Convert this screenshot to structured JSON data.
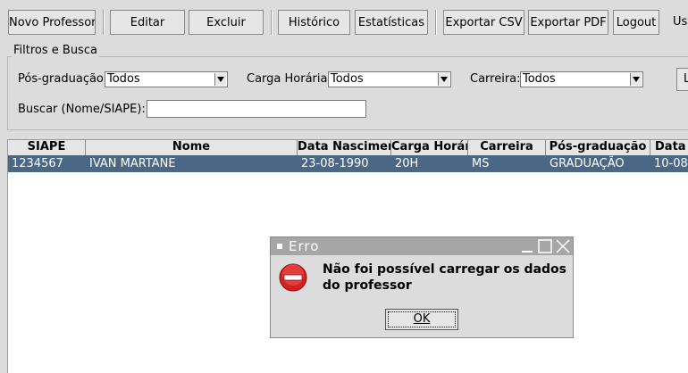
{
  "toolbar": {
    "novo_professor": "Novo Professor",
    "editar": "Editar",
    "excluir": "Excluir",
    "historico": "Histórico",
    "estatisticas": "Estatísticas",
    "exportar_csv": "Exportar CSV",
    "exportar_pdf": "Exportar PDF",
    "logout": "Logout",
    "usuario_partial": "Us"
  },
  "filters": {
    "legend": "Filtros e Busca",
    "pos_label": "Pós-graduação:",
    "pos_value": "Todos",
    "carga_label": "Carga Horária:",
    "carga_value": "Todos",
    "carreira_label": "Carreira:",
    "carreira_value": "Todos",
    "extra_partial": "L",
    "buscar_label": "Buscar (Nome/SIAPE):",
    "buscar_value": ""
  },
  "table": {
    "columns": [
      "SIAPE",
      "Nome",
      "Data Nascimento",
      "Carga Horária",
      "Carreira",
      "Pós-graduação",
      "Data"
    ],
    "rows": [
      [
        "1234567",
        "IVAN MARTANE",
        "23-08-1990",
        "20H",
        "MS",
        "GRADUAÇÃO",
        "10-08-"
      ]
    ]
  },
  "dialog": {
    "title": "Erro",
    "message": "Não foi possível carregar os dados do professor",
    "ok": "OK",
    "icon": "error-icon"
  },
  "colors": {
    "selected_row": "#4a6885",
    "titlebar": "#a6a6a6",
    "error_icon": "#d62020"
  }
}
